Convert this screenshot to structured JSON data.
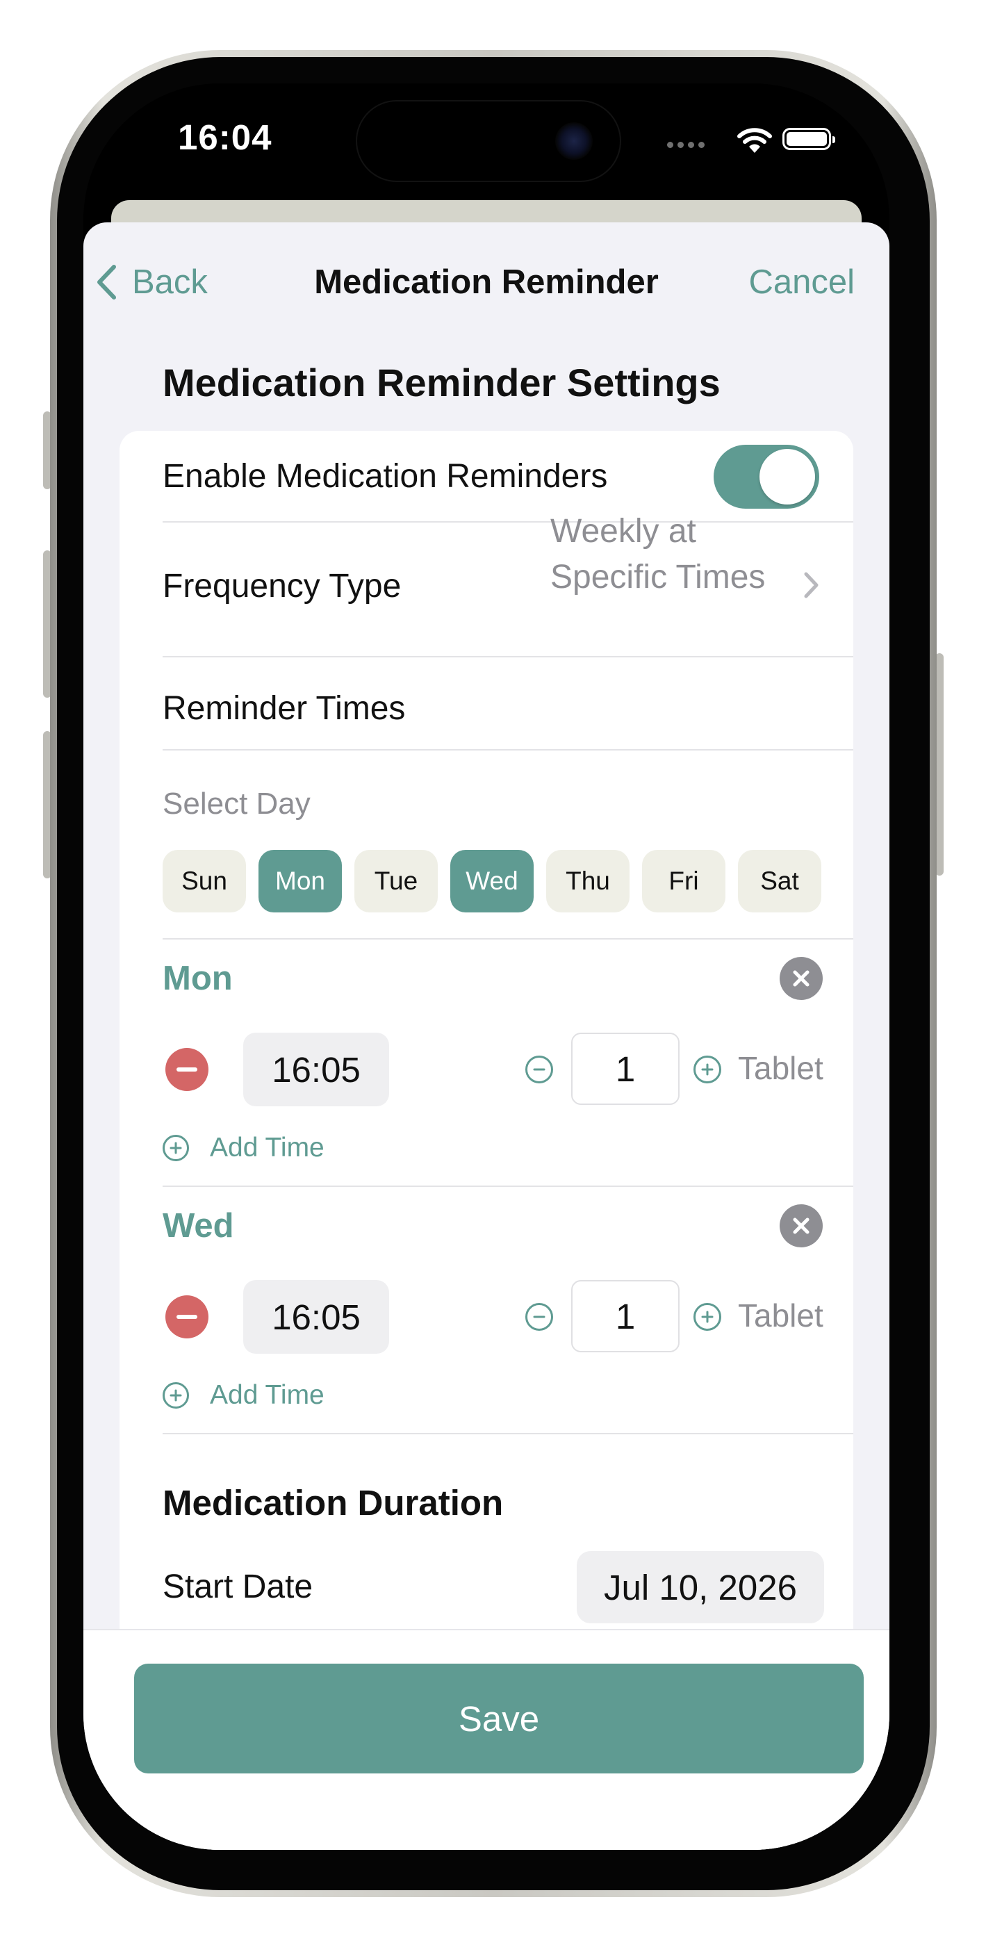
{
  "status_bar": {
    "time": "16:04"
  },
  "nav": {
    "back_label": "Back",
    "title": "Medication Reminder",
    "cancel_label": "Cancel"
  },
  "section_title": "Medication Reminder Settings",
  "enable_reminders": {
    "label": "Enable Medication Reminders",
    "on": true
  },
  "frequency": {
    "label": "Frequency Type",
    "value_line1": "Weekly at",
    "value_line2": "Specific Times"
  },
  "reminder_times_label": "Reminder Times",
  "select_day_label": "Select Day",
  "days": [
    {
      "label": "Sun",
      "selected": false
    },
    {
      "label": "Mon",
      "selected": true
    },
    {
      "label": "Tue",
      "selected": false
    },
    {
      "label": "Wed",
      "selected": true
    },
    {
      "label": "Thu",
      "selected": false
    },
    {
      "label": "Fri",
      "selected": false
    },
    {
      "label": "Sat",
      "selected": false
    }
  ],
  "schedules": [
    {
      "day": "Mon",
      "time": "16:05",
      "quantity": "1",
      "unit": "Tablet",
      "add_time_label": "Add Time"
    },
    {
      "day": "Wed",
      "time": "16:05",
      "quantity": "1",
      "unit": "Tablet",
      "add_time_label": "Add Time"
    }
  ],
  "duration": {
    "title": "Medication Duration",
    "start_label": "Start Date",
    "start_value": "Jul 10, 2026"
  },
  "save_label": "Save",
  "colors": {
    "accent": "#5f9b92",
    "delete": "#d46666",
    "day_chip": "#efefe6",
    "background": "#f2f2f7"
  }
}
